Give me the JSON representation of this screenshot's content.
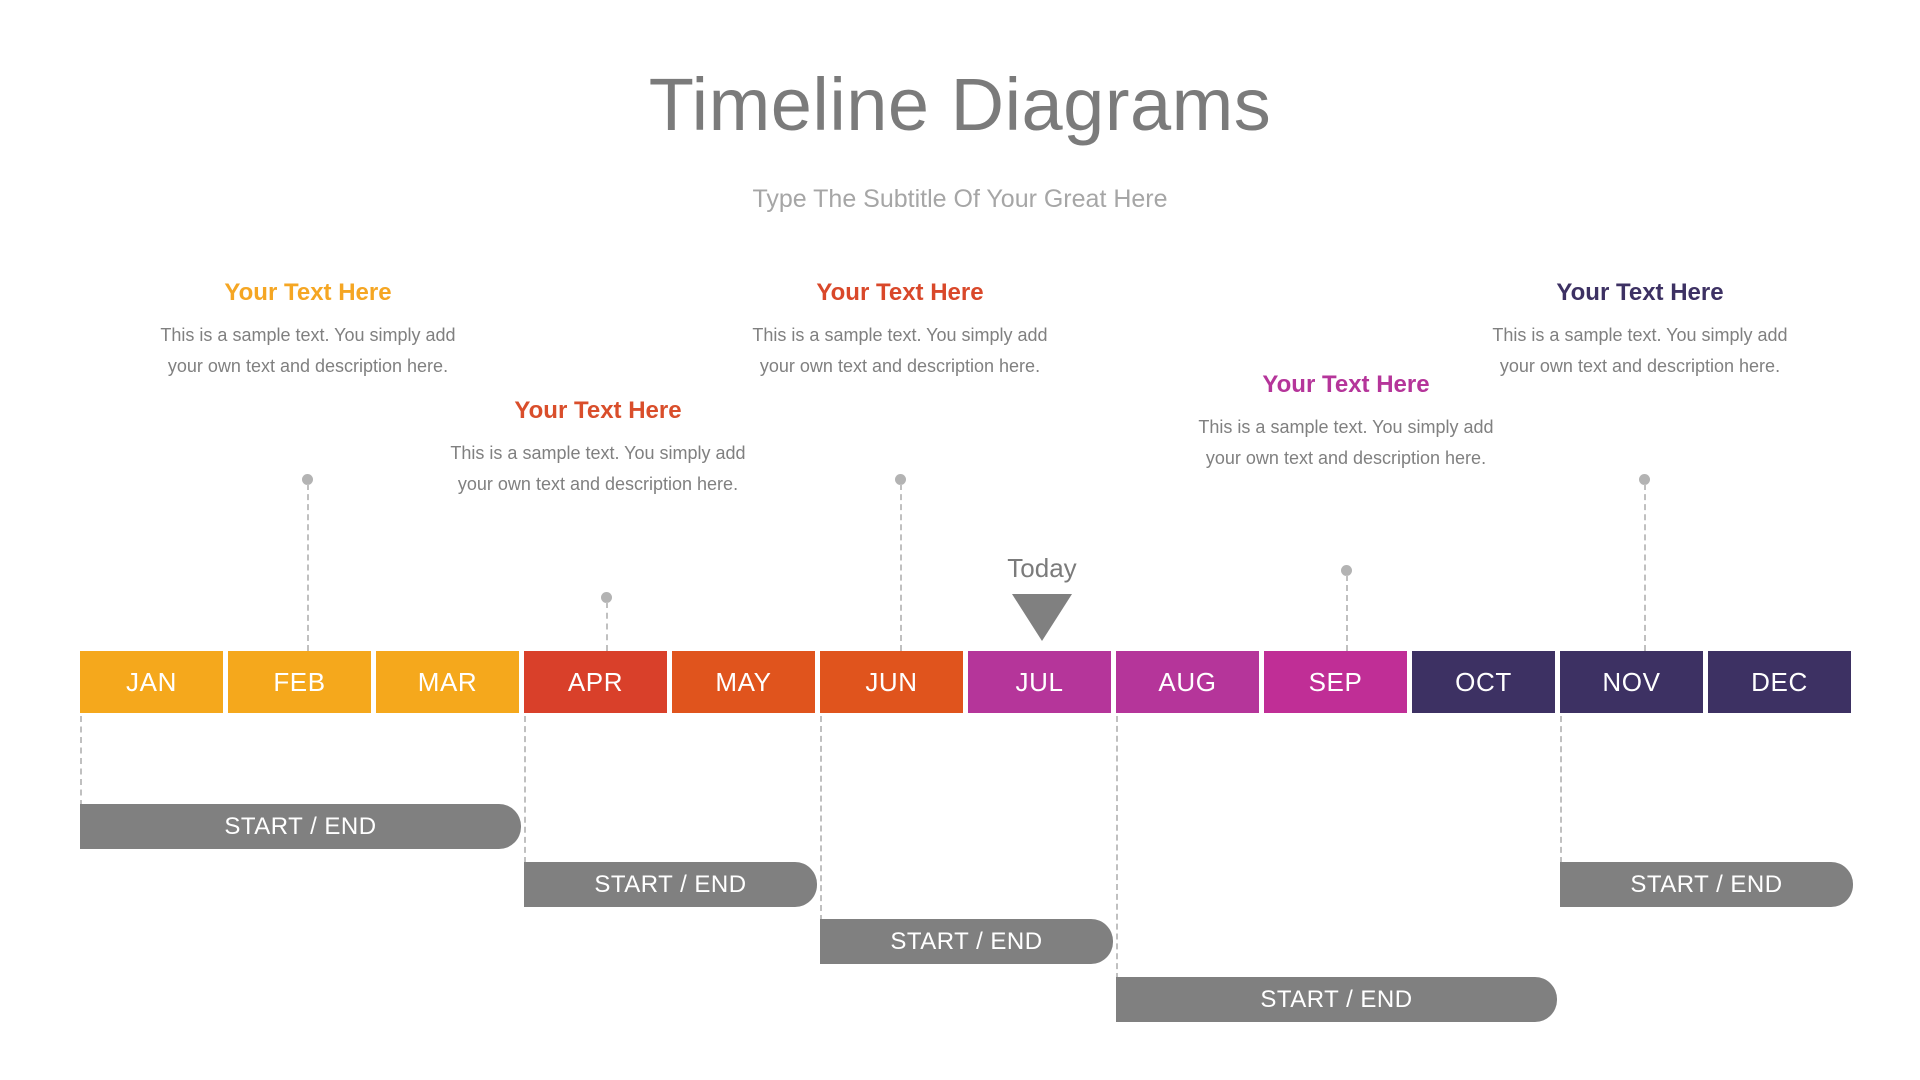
{
  "header": {
    "title": "Timeline Diagrams",
    "subtitle": "Type The Subtitle Of Your Great Here"
  },
  "today": {
    "label": "Today",
    "anchor_month": "JUL",
    "arrow_color": "#808080"
  },
  "callouts": [
    {
      "title": "Your Text Here",
      "body": "This is a sample text. You simply add your own text and description here.",
      "color": "#F5A623",
      "anchor_month": "FEB"
    },
    {
      "title": "Your Text Here",
      "body": "This is a sample text. You simply add your own text and description here.",
      "color": "#D94E2B",
      "anchor_month": "APR"
    },
    {
      "title": "Your Text Here",
      "body": "This is a sample text. You simply add your own text and description here.",
      "color": "#D9482A",
      "anchor_month": "JUN"
    },
    {
      "title": "Your Text Here",
      "body": "This is a sample text. You simply add your own text and description here.",
      "color": "#B5359A",
      "anchor_month": "SEP"
    },
    {
      "title": "Your Text Here",
      "body": "This is a sample text. You simply add your own text and description here.",
      "color": "#3D3163",
      "anchor_month": "NOV"
    }
  ],
  "timeline": {
    "months": [
      {
        "label": "JAN",
        "color": "#F5A81C"
      },
      {
        "label": "FEB",
        "color": "#F5A81C"
      },
      {
        "label": "MAR",
        "color": "#F5A81C"
      },
      {
        "label": "APR",
        "color": "#D9402A"
      },
      {
        "label": "MAY",
        "color": "#E0541D"
      },
      {
        "label": "JUN",
        "color": "#E0541D"
      },
      {
        "label": "JUL",
        "color": "#B5359A"
      },
      {
        "label": "AUG",
        "color": "#B5359A"
      },
      {
        "label": "SEP",
        "color": "#C02E96"
      },
      {
        "label": "OCT",
        "color": "#3D3163"
      },
      {
        "label": "NOV",
        "color": "#3D3163"
      },
      {
        "label": "DEC",
        "color": "#3D3163"
      }
    ]
  },
  "phases": [
    {
      "label": "START / END",
      "start_month": "JAN",
      "end_month": "MAR",
      "color": "#808080"
    },
    {
      "label": "START / END",
      "start_month": "APR",
      "end_month": "MAY",
      "color": "#808080"
    },
    {
      "label": "START / END",
      "start_month": "JUN",
      "end_month": "JUL",
      "color": "#808080"
    },
    {
      "label": "START / END",
      "start_month": "AUG",
      "end_month": "OCT",
      "color": "#808080"
    },
    {
      "label": "START / END",
      "start_month": "NOV",
      "end_month": "DEC",
      "color": "#808080"
    }
  ]
}
